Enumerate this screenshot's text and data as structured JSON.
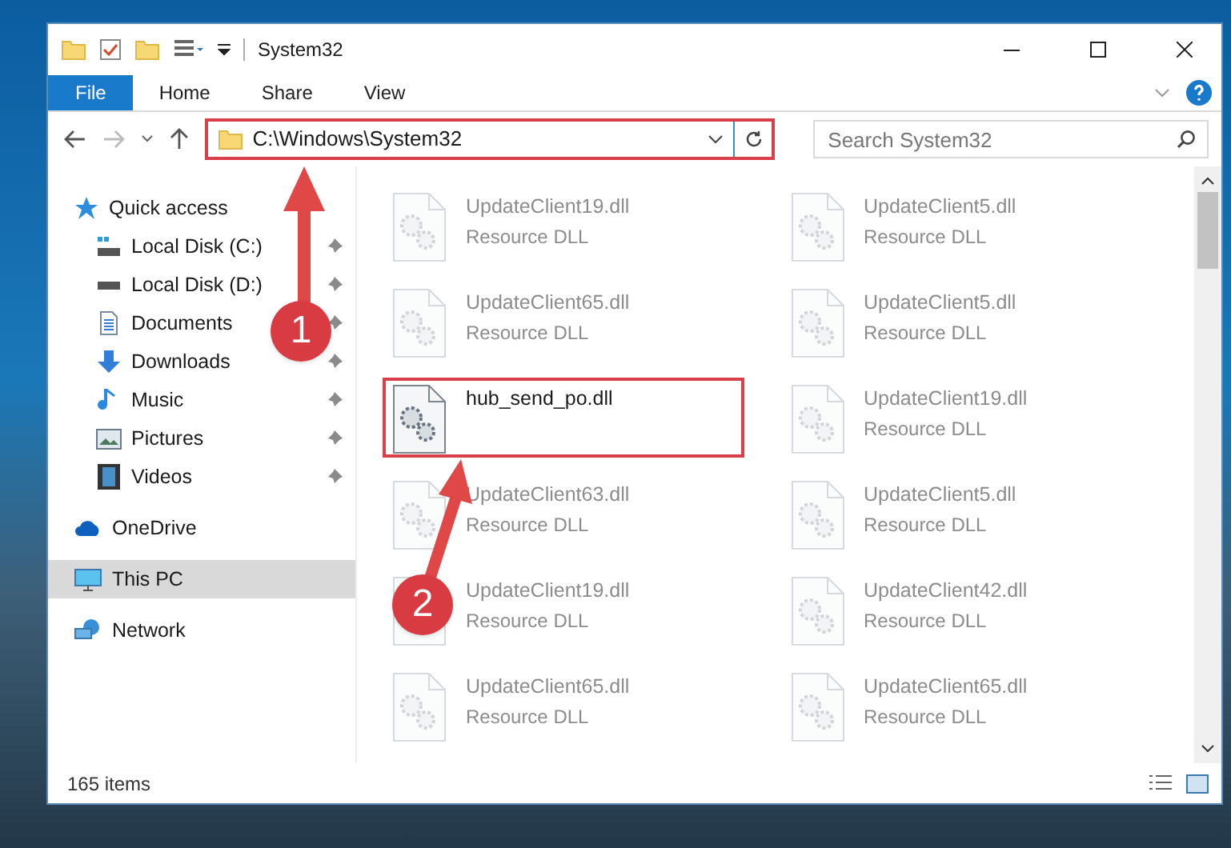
{
  "window": {
    "title": "System32"
  },
  "ribbon": {
    "tabs": [
      {
        "label": "File",
        "selected": true
      },
      {
        "label": "Home",
        "selected": false
      },
      {
        "label": "Share",
        "selected": false
      },
      {
        "label": "View",
        "selected": false
      }
    ]
  },
  "address_bar": {
    "path": "C:\\Windows\\System32",
    "highlighted": true
  },
  "search": {
    "placeholder": "Search System32"
  },
  "sidebar": {
    "items": [
      {
        "label": "Quick access",
        "selected": false,
        "children": [
          {
            "label": "Local Disk (C:)",
            "pinned": true
          },
          {
            "label": "Local Disk (D:)",
            "pinned": true
          },
          {
            "label": "Documents",
            "pinned": true
          },
          {
            "label": "Downloads",
            "pinned": true
          },
          {
            "label": "Music",
            "pinned": true
          },
          {
            "label": "Pictures",
            "pinned": true
          },
          {
            "label": "Videos",
            "pinned": true
          }
        ]
      },
      {
        "label": "OneDrive",
        "selected": false
      },
      {
        "label": "This PC",
        "selected": true
      },
      {
        "label": "Network",
        "selected": false
      }
    ]
  },
  "files": [
    {
      "name": "UpdateClient19.dll",
      "type": "Resource DLL",
      "highlighted": false
    },
    {
      "name": "UpdateClient5.dll",
      "type": "Resource DLL",
      "highlighted": false
    },
    {
      "name": "UpdateClient65.dll",
      "type": "Resource DLL",
      "highlighted": false
    },
    {
      "name": "UpdateClient5.dll",
      "type": "Resource DLL",
      "highlighted": false
    },
    {
      "name": "hub_send_po.dll",
      "highlighted": true
    },
    {
      "name": "UpdateClient19.dll",
      "type": "Resource DLL",
      "highlighted": false
    },
    {
      "name": "UpdateClient63.dll",
      "type": "Resource DLL",
      "highlighted": false
    },
    {
      "name": "UpdateClient5.dll",
      "type": "Resource DLL",
      "highlighted": false
    },
    {
      "name": "UpdateClient19.dll",
      "type": "Resource DLL",
      "highlighted": false
    },
    {
      "name": "UpdateClient42.dll",
      "type": "Resource DLL",
      "highlighted": false
    },
    {
      "name": "UpdateClient65.dll",
      "type": "Resource DLL",
      "highlighted": false
    },
    {
      "name": "UpdateClient65.dll",
      "type": "Resource DLL",
      "highlighted": false
    }
  ],
  "annotations": [
    {
      "label": "1"
    },
    {
      "label": "2"
    }
  ],
  "status_bar": {
    "count": "165 items"
  }
}
